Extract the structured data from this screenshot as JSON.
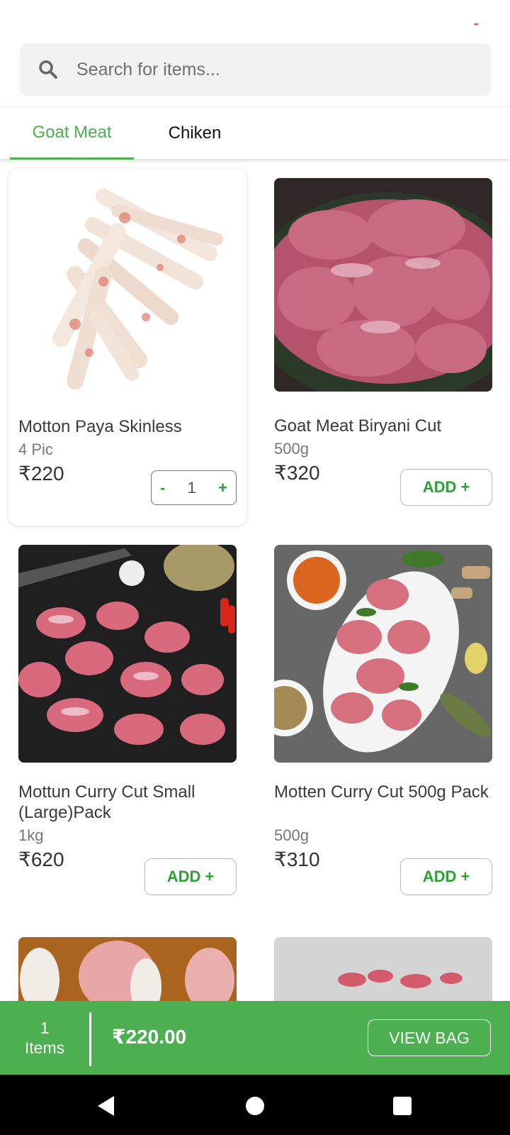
{
  "topbar": {
    "indicator": "-"
  },
  "search": {
    "placeholder": "Search for items..."
  },
  "tabs": [
    {
      "label": "Goat Meat",
      "active": true
    },
    {
      "label": "Chiken",
      "active": false
    }
  ],
  "products": [
    {
      "name": "Motton Paya Skinless",
      "qty": "4 Pic",
      "price": "₹220",
      "in_cart": true,
      "count": "1",
      "minus": "-",
      "plus": "+",
      "image": "goat-trotters-image"
    },
    {
      "name": "Goat Meat Biryani Cut",
      "qty": "500g",
      "price": "₹320",
      "in_cart": false,
      "add_label": "ADD +",
      "image": "biryani-cut-bowl-image"
    },
    {
      "name": "Mottun Curry Cut Small (Large)Pack",
      "qty": "1kg",
      "price": "₹620",
      "in_cart": false,
      "add_label": "ADD +",
      "image": "curry-cut-board-image"
    },
    {
      "name": "Motten Curry Cut 500g Pack",
      "qty": "500g",
      "price": "₹310",
      "in_cart": false,
      "add_label": "ADD +",
      "image": "curry-cut-dish-spices-image"
    }
  ],
  "bag": {
    "count": "1",
    "items_label": "Items",
    "total": "₹220.00",
    "view_label": "VIEW BAG"
  },
  "colors": {
    "accent": "#4caf50",
    "add_text": "#2ea036",
    "indicator": "#e8601c"
  }
}
